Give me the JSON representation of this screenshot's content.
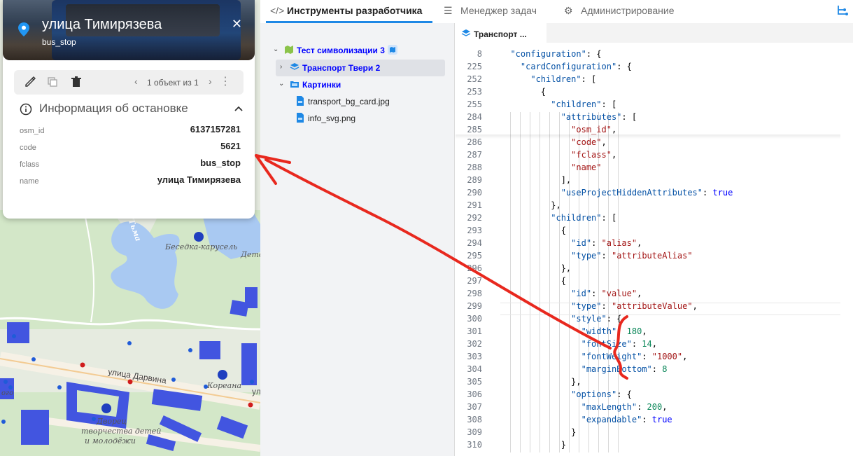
{
  "card": {
    "title": "улица Тимирязева",
    "subtitle": "bus_stop",
    "toolbar": {
      "pager": "1 объект из 1"
    },
    "section_title": "Информация об остановке",
    "attributes": [
      {
        "key": "osm_id",
        "value": "6137157281"
      },
      {
        "key": "code",
        "value": "5621"
      },
      {
        "key": "fclass",
        "value": "bus_stop"
      },
      {
        "key": "name",
        "value": "улица Тимирязева"
      }
    ]
  },
  "map": {
    "labels": [
      "Беседка-карусель",
      "улица Дарвина",
      "Кореана",
      "Дворец",
      "творчества детей",
      "и молодёжи",
      "Тьма",
      "Дето",
      "ул",
      "ого"
    ]
  },
  "topbar": {
    "tabs": [
      {
        "label": "Инструменты разработчика",
        "icon": "code-icon"
      },
      {
        "label": "Менеджер задач",
        "icon": "list-icon"
      },
      {
        "label": "Администрирование",
        "icon": "admin-settings-icon"
      }
    ]
  },
  "tree": {
    "items": [
      {
        "label": "Тест символизации 3",
        "icon": "map-icon",
        "expanded": true
      },
      {
        "label": "Транспорт Твери 2",
        "icon": "layer-icon",
        "selected": true
      },
      {
        "label": "Картинки",
        "icon": "folder-icon",
        "expanded": true
      },
      {
        "label": "transport_bg_card.jpg",
        "icon": "image-file-icon"
      },
      {
        "label": "info_svg.png",
        "icon": "image-file-icon"
      }
    ]
  },
  "editor": {
    "tab_label": "Транспорт ...",
    "lines": [
      {
        "n": "8",
        "text": "  \"configuration\": {"
      },
      {
        "n": "225",
        "text": "    \"cardConfiguration\": {"
      },
      {
        "n": "252",
        "text": "      \"children\": ["
      },
      {
        "n": "253",
        "text": "        {"
      },
      {
        "n": "255",
        "text": "          \"children\": ["
      },
      {
        "n": "284",
        "text": "            \"attributes\": ["
      },
      {
        "n": "285",
        "text": "              \"osm_id\","
      },
      {
        "n": "286",
        "text": "              \"code\","
      },
      {
        "n": "287",
        "text": "              \"fclass\","
      },
      {
        "n": "288",
        "text": "              \"name\""
      },
      {
        "n": "289",
        "text": "            ],"
      },
      {
        "n": "290",
        "text": "            \"useProjectHiddenAttributes\": true"
      },
      {
        "n": "291",
        "text": "          },"
      },
      {
        "n": "292",
        "text": "          \"children\": ["
      },
      {
        "n": "293",
        "text": "            {"
      },
      {
        "n": "294",
        "text": "              \"id\": \"alias\","
      },
      {
        "n": "295",
        "text": "              \"type\": \"attributeAlias\""
      },
      {
        "n": "296",
        "text": "            },"
      },
      {
        "n": "297",
        "text": "            {"
      },
      {
        "n": "298",
        "text": "              \"id\": \"value\","
      },
      {
        "n": "299",
        "text": "              \"type\": \"attributeValue\","
      },
      {
        "n": "300",
        "text": "              \"style\": {"
      },
      {
        "n": "301",
        "text": "                \"width\": 180,"
      },
      {
        "n": "302",
        "text": "                \"fontSize\": 14,"
      },
      {
        "n": "303",
        "text": "                \"fontWeight\": \"1000\","
      },
      {
        "n": "304",
        "text": "                \"marginBottom\": 8"
      },
      {
        "n": "305",
        "text": "              },"
      },
      {
        "n": "306",
        "text": "              \"options\": {"
      },
      {
        "n": "307",
        "text": "                \"maxLength\": 200,"
      },
      {
        "n": "308",
        "text": "                \"expandable\": true"
      },
      {
        "n": "309",
        "text": "              }"
      },
      {
        "n": "310",
        "text": "            }"
      }
    ]
  },
  "colors": {
    "accent": "#1e88e5",
    "annotation": "#e8281e",
    "building": "#4255e0",
    "water": "#a9c9f2",
    "park": "#d3e7c8"
  }
}
